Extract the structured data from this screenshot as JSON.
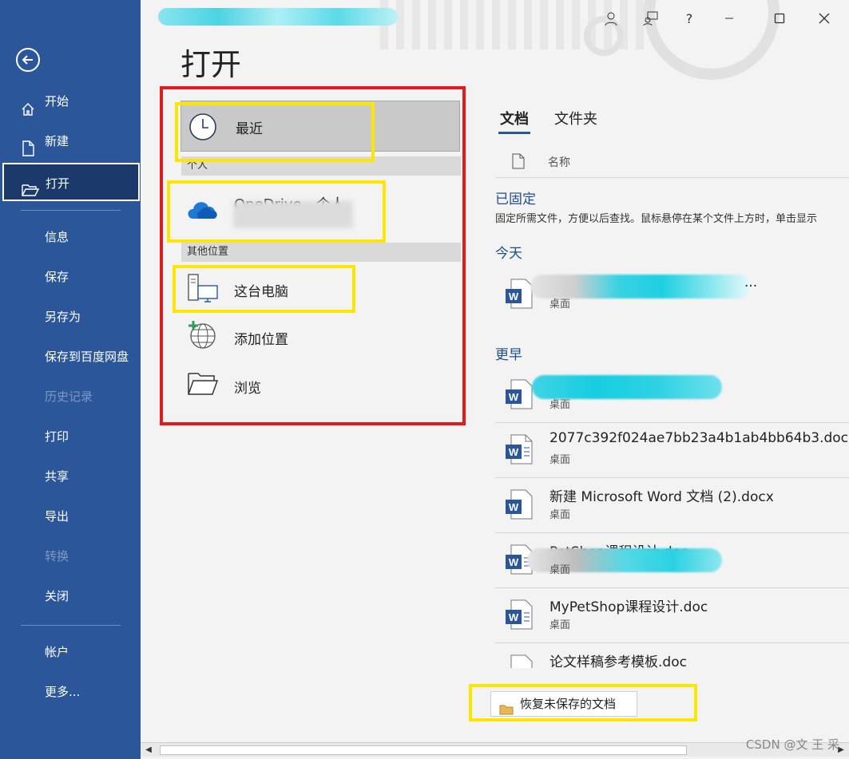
{
  "page_title": "打开",
  "sidebar": {
    "items": [
      {
        "label": "开始"
      },
      {
        "label": "新建"
      },
      {
        "label": "打开"
      },
      {
        "label": "信息"
      },
      {
        "label": "保存"
      },
      {
        "label": "另存为"
      },
      {
        "label": "保存到百度网盘"
      },
      {
        "label": "历史记录"
      },
      {
        "label": "打印"
      },
      {
        "label": "共享"
      },
      {
        "label": "导出"
      },
      {
        "label": "转换"
      },
      {
        "label": "关闭"
      },
      {
        "label": "帐户"
      },
      {
        "label": "更多..."
      }
    ]
  },
  "locations": {
    "recent": "最近",
    "personal_header": "个人",
    "onedrive": "OneDrive - 个人",
    "other_header": "其他位置",
    "this_pc": "这台电脑",
    "add_place": "添加位置",
    "browse": "浏览"
  },
  "tabs": {
    "documents": "文档",
    "folders": "文件夹"
  },
  "list": {
    "name_header": "名称",
    "pinned_title": "已固定",
    "pinned_hint": "固定所需文件，方便以后查找。鼠标悬停在某个文件上方时，单击显示",
    "today_title": "今天",
    "earlier_title": "更早",
    "today_files": [
      {
        "name": "...",
        "location": "桌面"
      }
    ],
    "earlier_files": [
      {
        "name": "",
        "location": "桌面"
      },
      {
        "name": "2077c392f024ae7bb23a4b1ab4bb64b3.doc",
        "location": "桌面"
      },
      {
        "name": "新建 Microsoft Word 文档 (2).docx",
        "location": "桌面"
      },
      {
        "name": "PetShop课程设计.doc",
        "location": "桌面"
      },
      {
        "name": "MyPetShop课程设计.doc",
        "location": "桌面"
      },
      {
        "name": "论文样稿参考模板.doc",
        "location": ""
      }
    ]
  },
  "recover_button": "恢复未保存的文档",
  "watermark": "CSDN @文 王 采",
  "window_controls": {
    "help": "?"
  }
}
